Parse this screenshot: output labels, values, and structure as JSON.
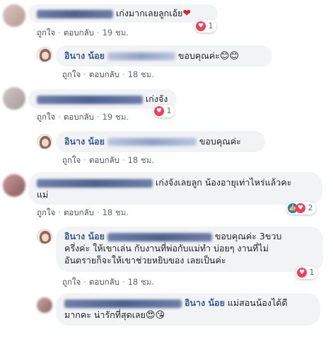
{
  "comments": [
    {
      "text": "เก่งมากเลยลูกเอ้ย",
      "emoji": "❤",
      "reaction_count": "1",
      "actions": {
        "like": "ถูกใจ",
        "reply": "ตอบกลับ",
        "time": "19 ชม."
      }
    },
    {
      "name": "อินาง น้อย",
      "text": "ขอบคุณค่ะ",
      "emoji": "😊😊",
      "actions": {
        "like": "ถูกใจ",
        "reply": "ตอบกลับ",
        "time": "18 ชม."
      }
    },
    {
      "text": "เก่งจัง",
      "reaction_count": "1",
      "actions": {
        "like": "ถูกใจ",
        "reply": "ตอบกลับ",
        "time": "19 ชม."
      }
    },
    {
      "name": "อินาง น้อย",
      "text": "ขอบคุณค่ะ",
      "actions": {
        "like": "ถูกใจ",
        "reply": "ตอบกลับ",
        "time": "18 ชม."
      }
    },
    {
      "text_line1": "เก่งจังเลยลูก น้องอายุเท่าไหร่แล้วคะ",
      "text_line2": "แม่",
      "reaction_count": "2",
      "actions": {
        "like": "ถูกใจ",
        "reply": "ตอบกลับ",
        "time": "18 ชม."
      }
    },
    {
      "name": "อินาง น้อย",
      "text_line1": "ขอบคุณค่ะ 3ขวบ",
      "text_line2": "ครึ่งค่ะ ให้เขาเล่น กับงานที่พ่อกับแม่ทำ บ่อยๆ งานที่ไม่",
      "text_line3": "อันตรายก็จะให้เขาช่วยหยิบของ เลยเป็นค่ะ",
      "reaction_count": "1",
      "actions": {
        "like": "ถูกใจ",
        "reply": "ตอบกลับ",
        "time": "18 ชม."
      }
    },
    {
      "mention": "อินาง น้อย",
      "text_line1": "แม่สอนน้องได้ดี",
      "text_line2": "มากคะ น่ารักที่สุดเลย",
      "emoji": "😍😘"
    }
  ],
  "colors": {
    "link": "#385898",
    "bubble": "#f2f3f5",
    "heart": "#f33e58",
    "like": "#1877f2",
    "meta": "#606770"
  }
}
